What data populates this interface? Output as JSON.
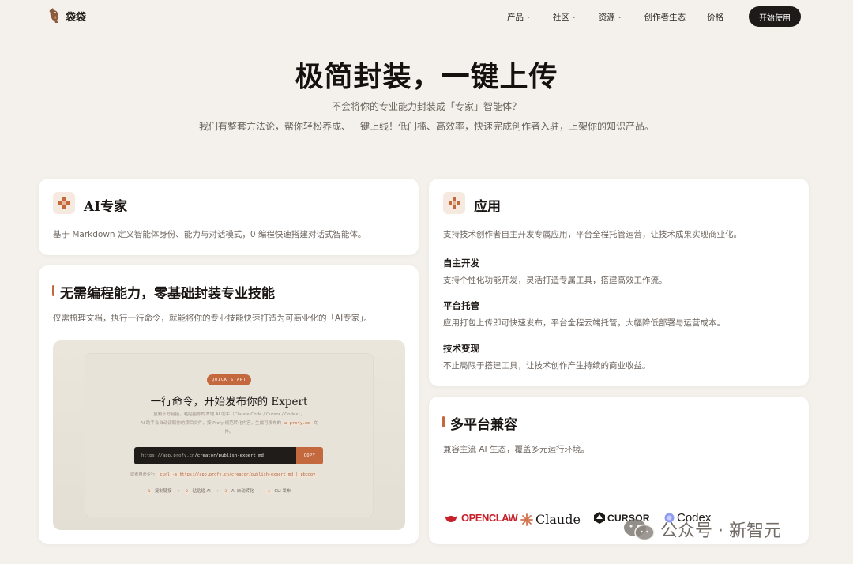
{
  "nav": {
    "logo_text": "袋袋",
    "items": [
      {
        "label": "产品",
        "chevron": true
      },
      {
        "label": "社区",
        "chevron": true
      },
      {
        "label": "资源",
        "chevron": true
      },
      {
        "label": "创作者生态",
        "chevron": false
      },
      {
        "label": "价格",
        "chevron": false
      }
    ],
    "chevron_glyph": "⌄",
    "start_button": "开始使用"
  },
  "hero": {
    "title": "极简封装，一键上传",
    "subtitle": "不会将你的专业能力封装成「专家」智能体？",
    "description": "我们有整套方法论，帮你轻松养成、一键上线！低门槛、高效率，快速完成创作者入驻，上架你的知识产品。"
  },
  "ai_expert": {
    "title": "AI专家",
    "description": "基于 Markdown 定义智能体身份、能力与对话模式，0 编程快速搭建对话式智能体。"
  },
  "apps": {
    "title": "应用",
    "description": "支持技术创作者自主开发专属应用，平台全程托管运营，让技术成果实现商业化。",
    "features": [
      {
        "title": "自主开发",
        "text": "支持个性化功能开发，灵活打造专属工具，搭建高效工作流。"
      },
      {
        "title": "平台托管",
        "text": "应用打包上传即可快速发布，平台全程云端托管，大幅降低部署与运营成本。"
      },
      {
        "title": "技术变现",
        "text": "不止局限于搭建工具，让技术创作产生持续的商业收益。"
      }
    ]
  },
  "no_code": {
    "title": "无需编程能力，零基础封装专业技能",
    "description": "仅需梳理文档，执行一行命令，就能将你的专业技能快速打造为可商业化的「AI专家」。"
  },
  "quickstart": {
    "badge": "QUICK START",
    "title": "一行命令，开始发布你的 Expert",
    "desc_line1": "复制下方链接，粘贴给你的本地 AI 助手（Claude Code / Cursor / Codex），",
    "desc_line2": "AI 助手会自动读取你的项目文件，按 Profy 规范转化内容，生成可发布的",
    "desc_code": "a-profy.md",
    "desc_tail": "文件。",
    "url_prefix": "https://app.profy.cn",
    "url_path": "/creator/publish-expert.md",
    "copy_label": "COPY",
    "alt_label": "或者用命令行",
    "alt_command": "curl -s https://app.profy.cn/creator/publish-expert.md | pbcopy",
    "steps": [
      {
        "num": "1",
        "label": "复制链接"
      },
      {
        "num": "2",
        "label": "粘贴给 AI"
      },
      {
        "num": "3",
        "label": "AI 自动转化"
      },
      {
        "num": "4",
        "label": "CLI 发布"
      }
    ],
    "arrow": "→"
  },
  "multi_platform": {
    "title": "多平台兼容",
    "description": "兼容主流 AI 生态，覆盖多元运行环境。",
    "platforms": [
      "OPENCLAW",
      "Claude",
      "CURSOR",
      "Codex"
    ]
  },
  "watermark": {
    "text": "公众号 · 新智元"
  },
  "colors": {
    "accent": "#c4683e",
    "background": "#f4f1ec",
    "dark_button": "#1d1a18"
  }
}
